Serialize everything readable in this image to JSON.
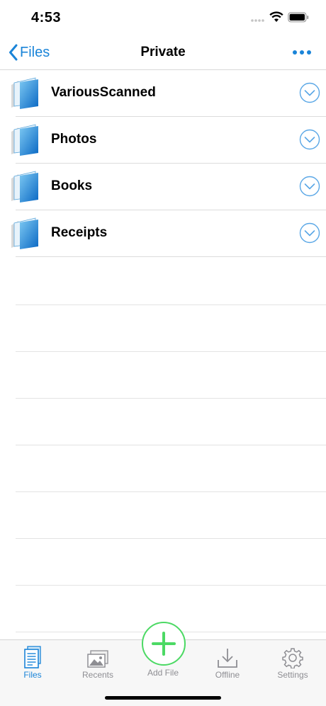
{
  "status_bar": {
    "time": "4:53"
  },
  "nav": {
    "back_label": "Files",
    "title": "Private"
  },
  "folders": [
    {
      "name": "VariousScanned"
    },
    {
      "name": "Photos"
    },
    {
      "name": "Books"
    },
    {
      "name": "Receipts"
    }
  ],
  "tabs": {
    "files": "Files",
    "recents": "Recents",
    "add_file": "Add File",
    "offline": "Offline",
    "settings": "Settings"
  },
  "colors": {
    "accent": "#1a84d8",
    "add_green": "#4cd964",
    "inactive": "#8e8e93"
  }
}
